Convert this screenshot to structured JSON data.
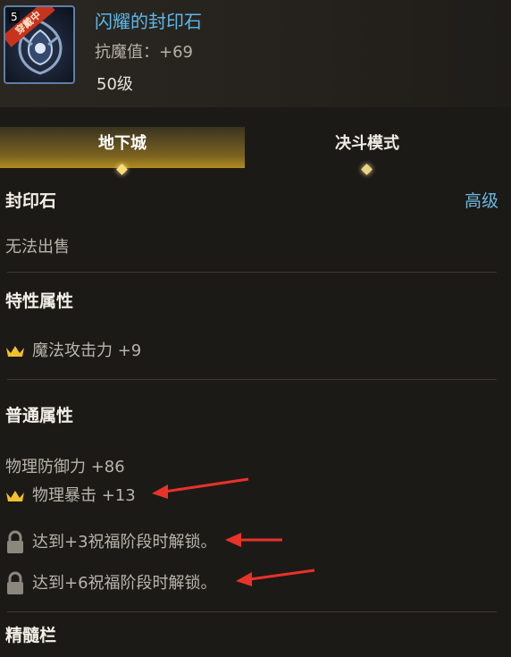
{
  "item": {
    "name": "闪耀的封印石",
    "stat": "抗魔值：+69",
    "level": "50级",
    "badge": "穿戴中",
    "icon": "seal-stone-icon",
    "corner_level": "5"
  },
  "tabs": [
    {
      "label": "地下城",
      "active": true
    },
    {
      "label": "决斗模式",
      "active": false
    }
  ],
  "category": {
    "type": "封印石",
    "grade": "高级",
    "sell_status": "无法出售"
  },
  "special_attributes": {
    "title": "特性属性",
    "items": [
      {
        "text": "魔法攻击力 +9",
        "icon": "crown-icon"
      }
    ]
  },
  "normal_attributes": {
    "title": "普通属性",
    "items": [
      {
        "text": "物理防御力 +86",
        "icon": ""
      },
      {
        "text": "物理暴击 +13",
        "icon": "crown-icon"
      },
      {
        "text": "达到+3祝福阶段时解锁。",
        "icon": "lock-icon"
      },
      {
        "text": "达到+6祝福阶段时解锁。",
        "icon": "lock-icon"
      }
    ]
  },
  "essence_slot": {
    "title": "精髓栏"
  },
  "colors": {
    "name": "#5cb8e8",
    "grade": "#6ab8e0",
    "tab_active": "#b18c1f",
    "arrow": "#e8322a",
    "crown": "#f2c02c"
  }
}
